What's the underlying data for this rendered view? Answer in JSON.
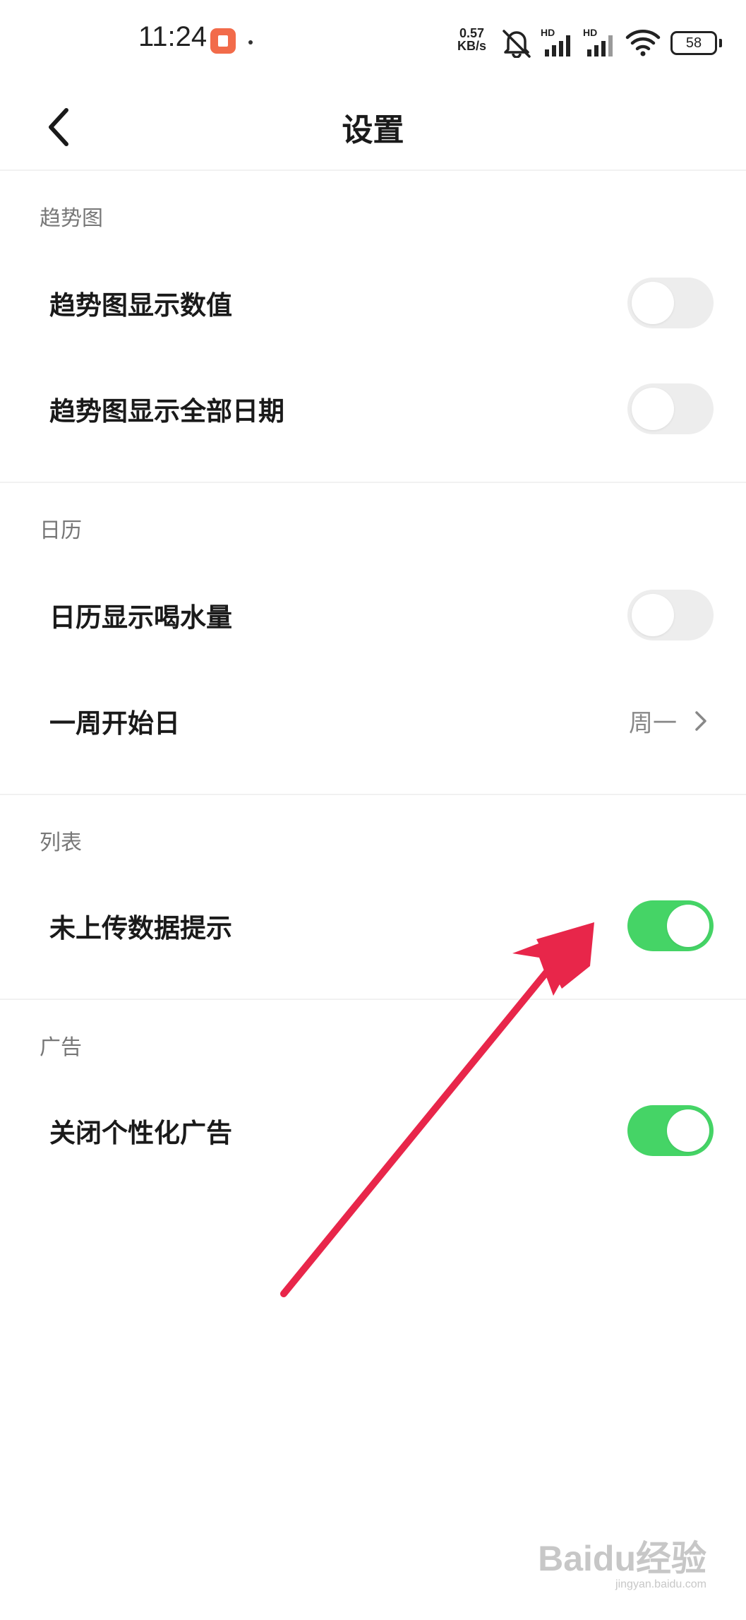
{
  "status_bar": {
    "time": "11:24",
    "net_speed_value": "0.57",
    "net_speed_unit": "KB/s",
    "sim1_label": "HD",
    "sim2_label": "HD",
    "battery": "58"
  },
  "header": {
    "title": "设置"
  },
  "sections": [
    {
      "title": "趋势图",
      "rows": [
        {
          "label": "趋势图显示数值",
          "toggle": false
        },
        {
          "label": "趋势图显示全部日期",
          "toggle": false
        }
      ]
    },
    {
      "title": "日历",
      "rows": [
        {
          "label": "日历显示喝水量",
          "toggle": false
        },
        {
          "label": "一周开始日",
          "value": "周一"
        }
      ]
    },
    {
      "title": "列表",
      "rows": [
        {
          "label": "未上传数据提示",
          "toggle": true
        }
      ]
    },
    {
      "title": "广告",
      "rows": [
        {
          "label": "关闭个性化广告",
          "toggle": true
        }
      ]
    }
  ],
  "colors": {
    "toggle_on": "#45d466",
    "toggle_off": "#ededed",
    "annotation_arrow": "#e8264a"
  },
  "watermark": {
    "logo": "Baidu经验",
    "url": "jingyan.baidu.com"
  }
}
